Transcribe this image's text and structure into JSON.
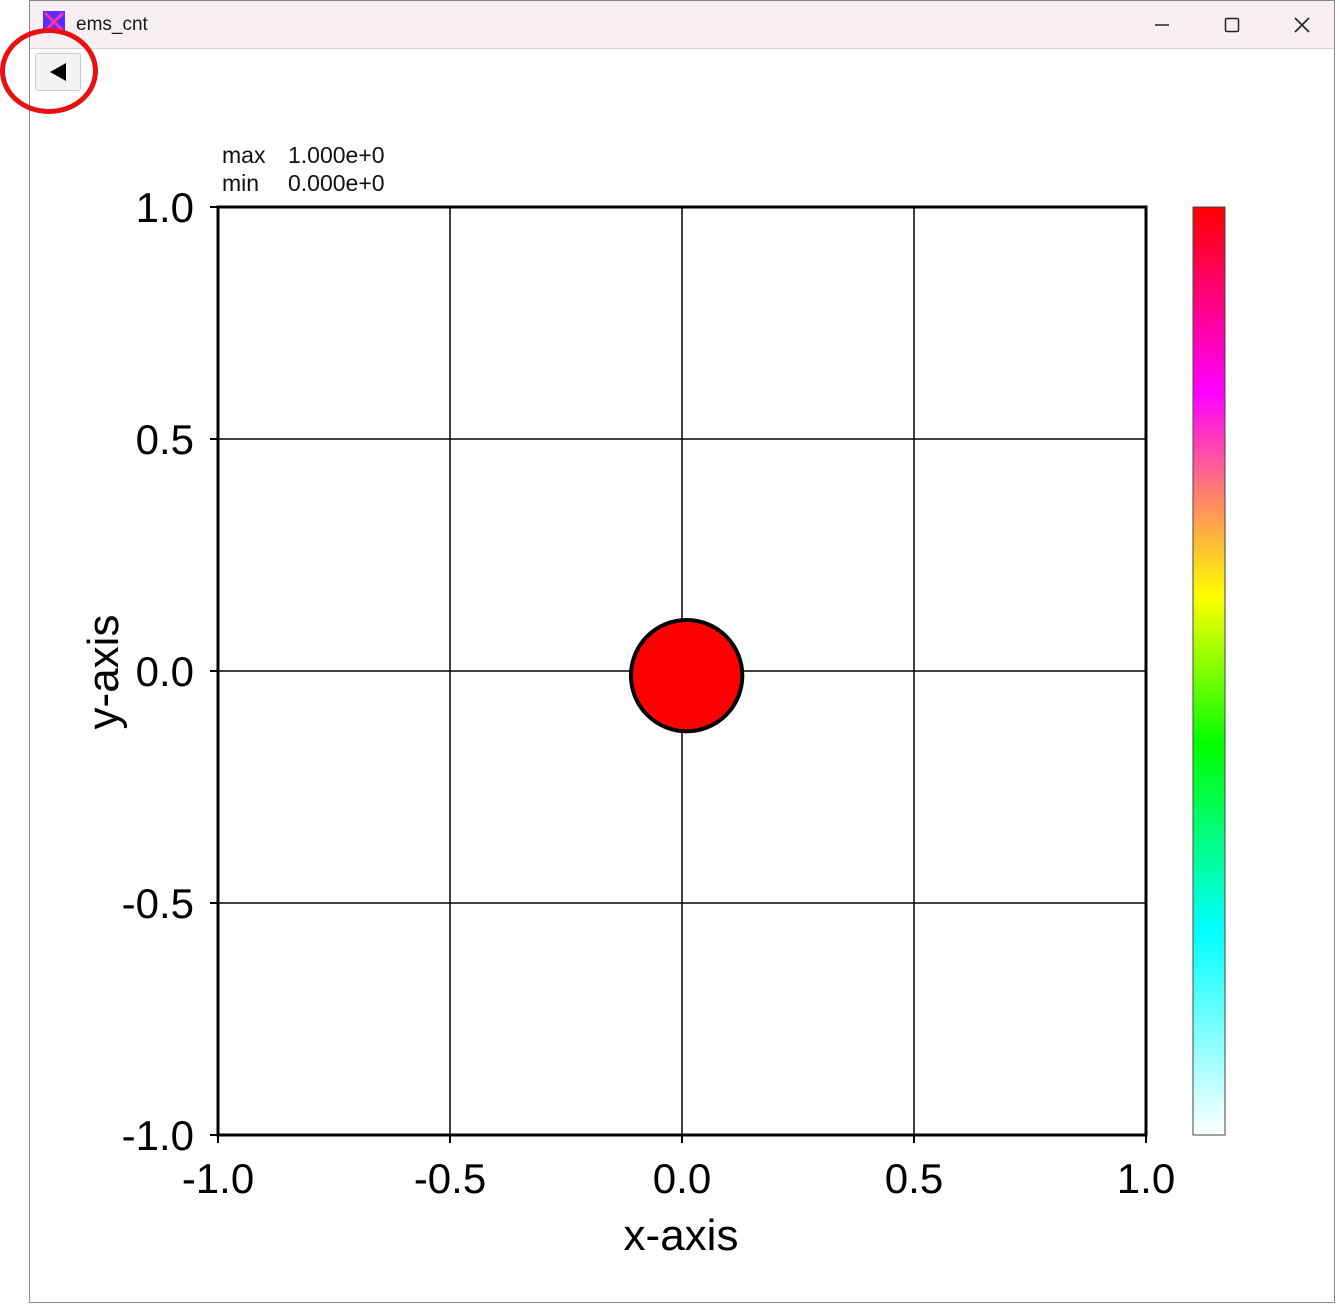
{
  "window": {
    "title": "ems_cnt",
    "icons": {
      "app": "app-icon",
      "minimize": "minimize-icon",
      "maximize": "maximize-icon",
      "close": "close-icon"
    }
  },
  "toolbar": {
    "back_button_icon": "back-arrow-icon",
    "highlight_color": "#e81010"
  },
  "stats": {
    "max_label": "max",
    "max_value": "1.000e+0",
    "min_label": "min",
    "min_value": "0.000e+0"
  },
  "chart_data": {
    "type": "heatmap",
    "xlabel": "x-axis",
    "ylabel": "y-axis",
    "xlim": [
      -1.0,
      1.0
    ],
    "ylim": [
      -1.0,
      1.0
    ],
    "xticks": [
      "-1.0",
      "-0.5",
      "0.0",
      "0.5",
      "1.0"
    ],
    "yticks": [
      "1.0",
      "0.5",
      "0.0",
      "-0.5",
      "-1.0"
    ],
    "xtick_values": [
      -1.0,
      -0.5,
      0.0,
      0.5,
      1.0
    ],
    "ytick_values": [
      1.0,
      0.5,
      0.0,
      -0.5,
      -1.0
    ],
    "grid": true,
    "shape": {
      "kind": "disk",
      "center": [
        0.01,
        -0.01
      ],
      "radius": 0.12,
      "value": 1.0,
      "fill_color": "#ff0000",
      "edge_color": "#000000"
    },
    "colorbar": {
      "min": 0.0,
      "max": 1.0,
      "colors": [
        "#ffffff",
        "#00ffff",
        "#00ff00",
        "#ffff00",
        "#ff00ff",
        "#ff0000"
      ]
    }
  }
}
